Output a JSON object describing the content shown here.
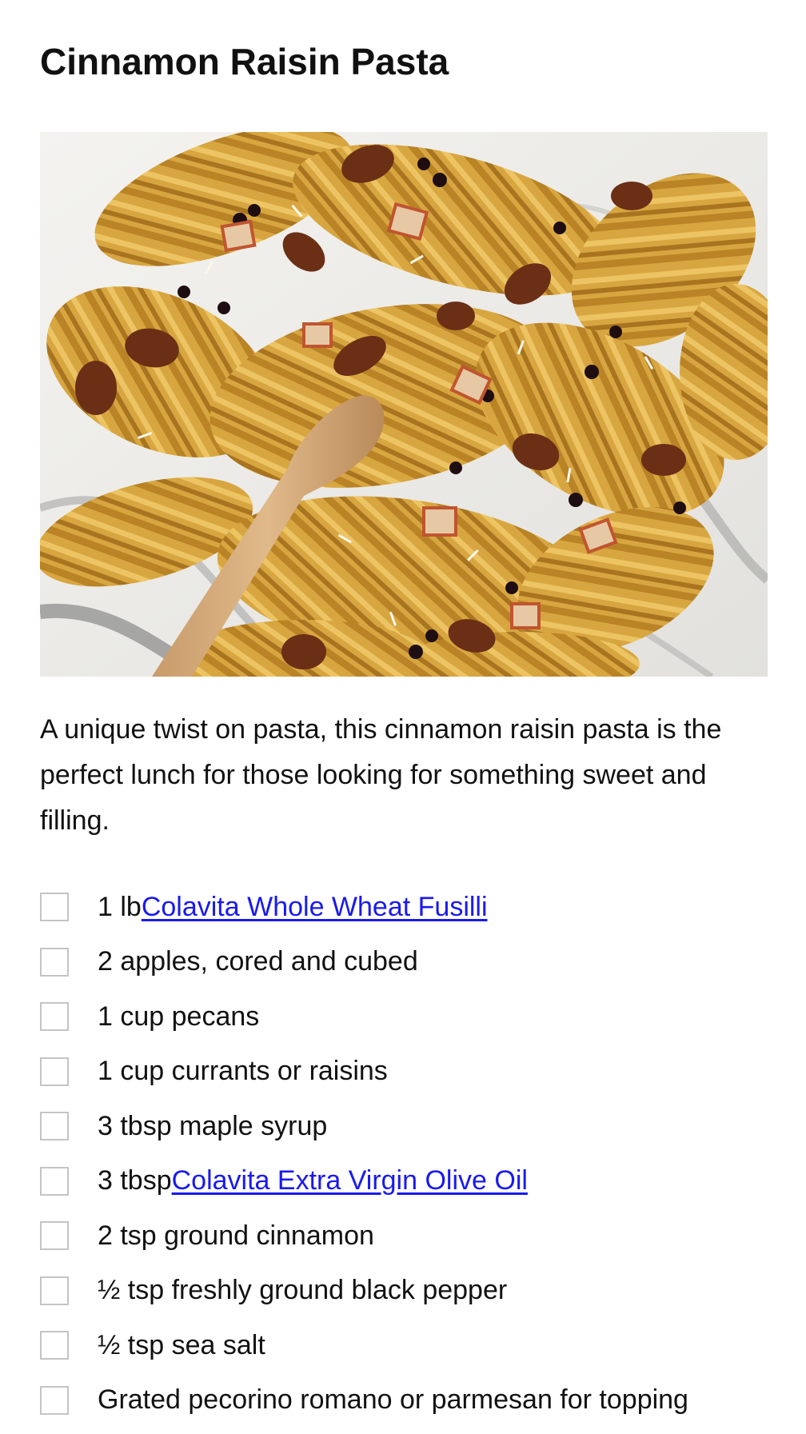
{
  "recipe": {
    "title": "Cinnamon Raisin Pasta",
    "description": "A unique twist on pasta, this cinnamon raisin pasta is the perfect lunch for those looking for something sweet and filling.",
    "ingredients": [
      {
        "text": "1 lb ",
        "link": "Colavita Whole Wheat Fusilli"
      },
      {
        "text": "2 apples, cored and cubed",
        "link": ""
      },
      {
        "text": "1 cup pecans",
        "link": ""
      },
      {
        "text": "1 cup currants or raisins",
        "link": ""
      },
      {
        "text": "3 tbsp maple syrup",
        "link": ""
      },
      {
        "text": "3 tbsp ",
        "link": "Colavita Extra Virgin Olive Oil"
      },
      {
        "text": "2 tsp ground cinnamon",
        "link": ""
      },
      {
        "text": "½ tsp freshly ground black pepper",
        "link": ""
      },
      {
        "text": "½ tsp sea salt",
        "link": ""
      },
      {
        "text": "Grated pecorino romano or parmesan for topping",
        "link": ""
      }
    ]
  },
  "colors": {
    "link": "#1a1aee",
    "text": "#111111",
    "checkbox_border": "#c4c4c4"
  }
}
